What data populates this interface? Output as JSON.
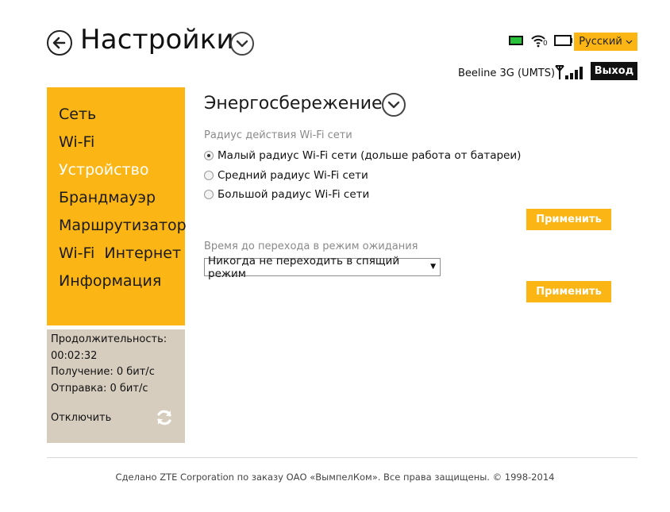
{
  "header": {
    "title": "Настройки",
    "language": "Русский",
    "network": "Beeline 3G (UMTS)",
    "logout": "Выход",
    "wifi_clients": "0"
  },
  "sidebar": {
    "items": [
      {
        "label": "Сеть",
        "active": false
      },
      {
        "label": "Wi-Fi",
        "active": false
      },
      {
        "label": "Устройство",
        "active": true
      },
      {
        "label": "Брандмауэр",
        "active": false
      },
      {
        "label": "Маршрутизатор",
        "active": false
      },
      {
        "label": "Wi-Fi  Интернет",
        "active": false
      },
      {
        "label": "Информация",
        "active": false
      }
    ]
  },
  "stats": {
    "duration_label": "Продолжительность:",
    "duration_value": "00:02:32",
    "receive": "Получение: 0 бит/с",
    "send": "Отправка: 0 бит/с",
    "disconnect": "Отключить"
  },
  "main": {
    "section_title": "Энергосбережение",
    "wifi_range": {
      "label": "Радиус действия Wi-Fi сети",
      "options": [
        {
          "label": "Малый радиус Wi-Fi сети (дольше работа от батареи)",
          "checked": true
        },
        {
          "label": "Средний радиус Wi-Fi сети",
          "checked": false
        },
        {
          "label": "Большой радиус Wi-Fi сети",
          "checked": false
        }
      ],
      "apply": "Применить"
    },
    "sleep": {
      "label": "Время до перехода в режим ожидания",
      "selected": "Никогда не переходить в спящий режим",
      "apply": "Применить"
    }
  },
  "footer": {
    "text": "Сделано ZTE Corporation по заказу ОАО «ВымпелКом». Все права защищены. © 1998-2014"
  },
  "colors": {
    "accent": "#fbb515",
    "stats_bg": "#d6cdbf"
  }
}
